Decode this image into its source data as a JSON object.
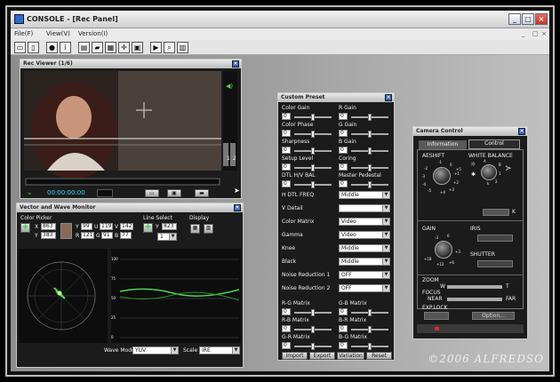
{
  "window": {
    "title": "CONSOLE - [Rec Panel]"
  },
  "menu": {
    "file": "File(F)",
    "view": "View(V)",
    "version": "Version(I)"
  },
  "rec_viewer": {
    "title": "Rec Viewer (1/6)",
    "timecode": "00:00:00:00",
    "meter_labels": [
      "1",
      "2"
    ]
  },
  "vector": {
    "title": "Vector and Wave Monitor",
    "color_picker": "Color Picker",
    "line_select": "Line Select",
    "display": "Display",
    "X_label": "X",
    "X": "863",
    "Y_label": "Y",
    "Y": "383",
    "Y2_label": "Y",
    "Y2": "99",
    "U_label": "U",
    "U": "119",
    "V_label": "V",
    "V": "142",
    "R_label": "R",
    "R": "121",
    "G_label": "G",
    "G": "91",
    "B_label": "B",
    "B": "77",
    "line_y_label": "Y",
    "line_value": "823",
    "line_select_value": "1",
    "wave_mode_label": "Wave Mode",
    "wave_mode": "YUV",
    "scale_label": "Scale",
    "scale": "IRE",
    "scale_ticks": [
      "100",
      "75",
      "50",
      "25",
      "0"
    ]
  },
  "custom_preset": {
    "title": "Custom Preset",
    "pairs": [
      {
        "left": "Color Gain",
        "lv": "0",
        "right": "R Gain",
        "rv": "0"
      },
      {
        "left": "Color Phase",
        "lv": "0",
        "right": "G Gain",
        "rv": "0"
      },
      {
        "left": "Sharpness",
        "lv": "0",
        "right": "B Gain",
        "rv": "0"
      },
      {
        "left": "Setup Level",
        "lv": "0",
        "right": "Coring",
        "rv": "0"
      },
      {
        "left": "DTL H/V BAL",
        "lv": "0",
        "right": "Master Pedestal",
        "rv": "0"
      }
    ],
    "selects": [
      {
        "label": "H DTL FREQ",
        "value": "Middle"
      },
      {
        "label": "V Detail",
        "value": ""
      },
      {
        "label": "Color Matrix",
        "value": "Video"
      },
      {
        "label": "Gamma",
        "value": "Video"
      },
      {
        "label": "Knee",
        "value": "Middle"
      },
      {
        "label": "Black",
        "value": "Middle"
      },
      {
        "label": "Noise Reduction 1",
        "value": "OFF"
      },
      {
        "label": "Noise Reduction 2",
        "value": "OFF"
      }
    ],
    "matrix": [
      {
        "left": "R-G Matrix",
        "lv": "0",
        "right": "G-B Matrix",
        "rv": "0"
      },
      {
        "left": "R-B Matrix",
        "lv": "0",
        "right": "B-R Matrix",
        "rv": "0"
      },
      {
        "left": "G-R Matrix",
        "lv": "0",
        "right": "B-G Matrix",
        "rv": "0"
      }
    ],
    "buttons": {
      "import": "Import",
      "export": "Export",
      "variation": "Variation",
      "reset": "Reset"
    }
  },
  "camera_control": {
    "title": "Camera Control",
    "tabs": {
      "information": "Information",
      "control": "Control"
    },
    "aeshift": "AESHIFT",
    "aeshift_ticks": [
      "-1",
      "0",
      "+1",
      "-2",
      "+2",
      "-3",
      "+3",
      "-4",
      "+4",
      "-5",
      "+5"
    ],
    "white_balance": "WHITE BALANCE",
    "wb_marks": [
      "A",
      "B",
      "1",
      "k",
      "2"
    ],
    "wb_unit": "K",
    "gain": "GAIN",
    "gain_ticks": [
      "-3",
      "0",
      "+3",
      "+6",
      "+12",
      "+18"
    ],
    "iris": "IRIS",
    "shutter": "SHUTTER",
    "zoom": "ZOOM",
    "zoom_w": "W",
    "zoom_t": "T",
    "focus": "FOCUS",
    "focus_near": "NEAR",
    "focus_far": "FAR",
    "exp_lock": "EXP.LOCK",
    "option": "Option..."
  },
  "watermark": "©2006 ALFREDSO",
  "colors": {
    "panel_bg": "#1b1b1b",
    "accent_green": "#4cd84c",
    "timecode": "#3fd6ff"
  }
}
